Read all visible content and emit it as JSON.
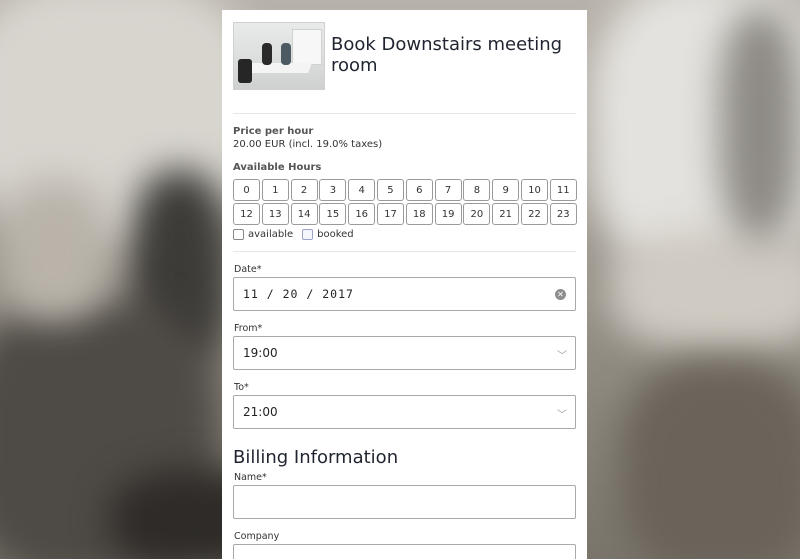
{
  "room": {
    "title": "Book Downstairs meeting room",
    "image": "meeting-room-photo"
  },
  "pricing": {
    "label": "Price per hour",
    "value": "20.00 EUR (incl. 19.0% taxes)"
  },
  "availability": {
    "label": "Available Hours",
    "hours": [
      "0",
      "1",
      "2",
      "3",
      "4",
      "5",
      "6",
      "7",
      "8",
      "9",
      "10",
      "11",
      "12",
      "13",
      "14",
      "15",
      "16",
      "17",
      "18",
      "19",
      "20",
      "21",
      "22",
      "23"
    ],
    "legend_available": "available",
    "legend_booked": "booked"
  },
  "form": {
    "date_label": "Date*",
    "date_value": "11 / 20 / 2017",
    "from_label": "From*",
    "from_value": "19:00",
    "to_label": "To*",
    "to_value": "21:00"
  },
  "billing": {
    "title": "Billing Information",
    "name_label": "Name*",
    "name_value": "",
    "company_label": "Company",
    "company_value": ""
  },
  "icons": {
    "clear": "clear-circle-icon",
    "dropdown": "chevron-down-icon"
  }
}
